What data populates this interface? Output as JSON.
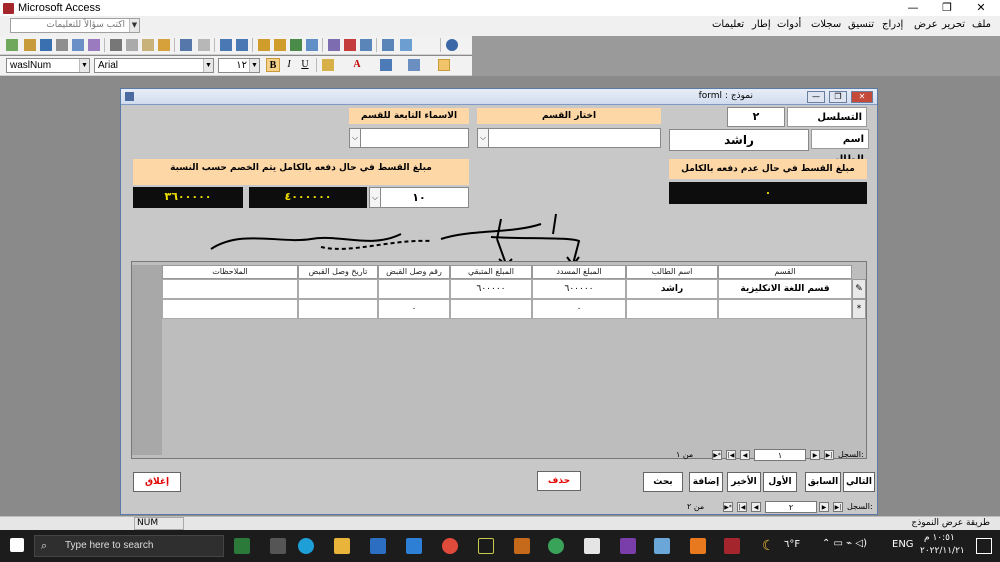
{
  "app": {
    "title": "Microsoft Access",
    "help_placeholder": "اكتب سؤالاً للتعليمات"
  },
  "menu": {
    "items": [
      "ملف",
      "تحرير",
      "عرض",
      "إدراج",
      "تنسيق",
      "سجلات",
      "أدوات",
      "إطار",
      "تعليمات"
    ]
  },
  "toolbar": {
    "field_combo": "waslNum",
    "font_combo": "Arial",
    "size_combo": "١٢",
    "bold": "B",
    "italic": "I",
    "underline": "U"
  },
  "form": {
    "title": "forml : نموذج",
    "serial_label": "التسلسل",
    "serial_value": "٢",
    "student_label": "اسم الطالب",
    "student_value": "راشد",
    "choose_dept_label": "اختار القسم",
    "dept_names_label": "الاسماء التابعة للقسم",
    "full_payment_label": "مبلغ القسط في حال دفعه بالكامل يتم الخصم حسب النسبة",
    "discount_value": "١٠",
    "full_amount": "٤٠٠٠٠٠٠",
    "discounted_amount": "٣٦٠٠٠٠٠",
    "partial_payment_label": "مبلغ القسط في حال عدم دفعه بالكامل",
    "partial_value": "٠"
  },
  "grid": {
    "headers": [
      "القسم",
      "اسم الطالب",
      "المبلغ المسدد",
      "المبلغ المتبقي",
      "رقم وصل القبض",
      "تاريخ وصل القبض",
      "الملاحظات"
    ],
    "rows": [
      [
        "قسم اللغة الانكليزية",
        "راشد",
        "٦٠٠٠٠٠",
        "٦٠٠٠٠٠",
        "",
        "",
        ""
      ],
      [
        "",
        "",
        "٠",
        "",
        "٠",
        "",
        ""
      ]
    ],
    "nav_label": "السجل:",
    "nav_value": "١",
    "nav_of": "من ١"
  },
  "buttons": {
    "next": "التالي",
    "prev": "السابق",
    "first": "الأول",
    "last": "الأخير",
    "add": "إضافة",
    "search": "بحث",
    "delete": "حذف",
    "close": "إغلاق"
  },
  "form_nav": {
    "label": "السجل:",
    "value": "٢",
    "of": "من ٢"
  },
  "status": {
    "left": "طريقة عرض النموذج",
    "num": "NUM"
  },
  "taskbar": {
    "search_placeholder": "Type here to search",
    "temperature": "٦°F",
    "lang": "ENG",
    "time": "١٠:٥١ م",
    "date": "٢٠٢٢/١١/٢١"
  },
  "colors": {
    "peach": "#fdd7a6",
    "dark_field": "#0d0d0d",
    "yellow_text": "#f0e000",
    "button_red_text": "#e00000"
  }
}
